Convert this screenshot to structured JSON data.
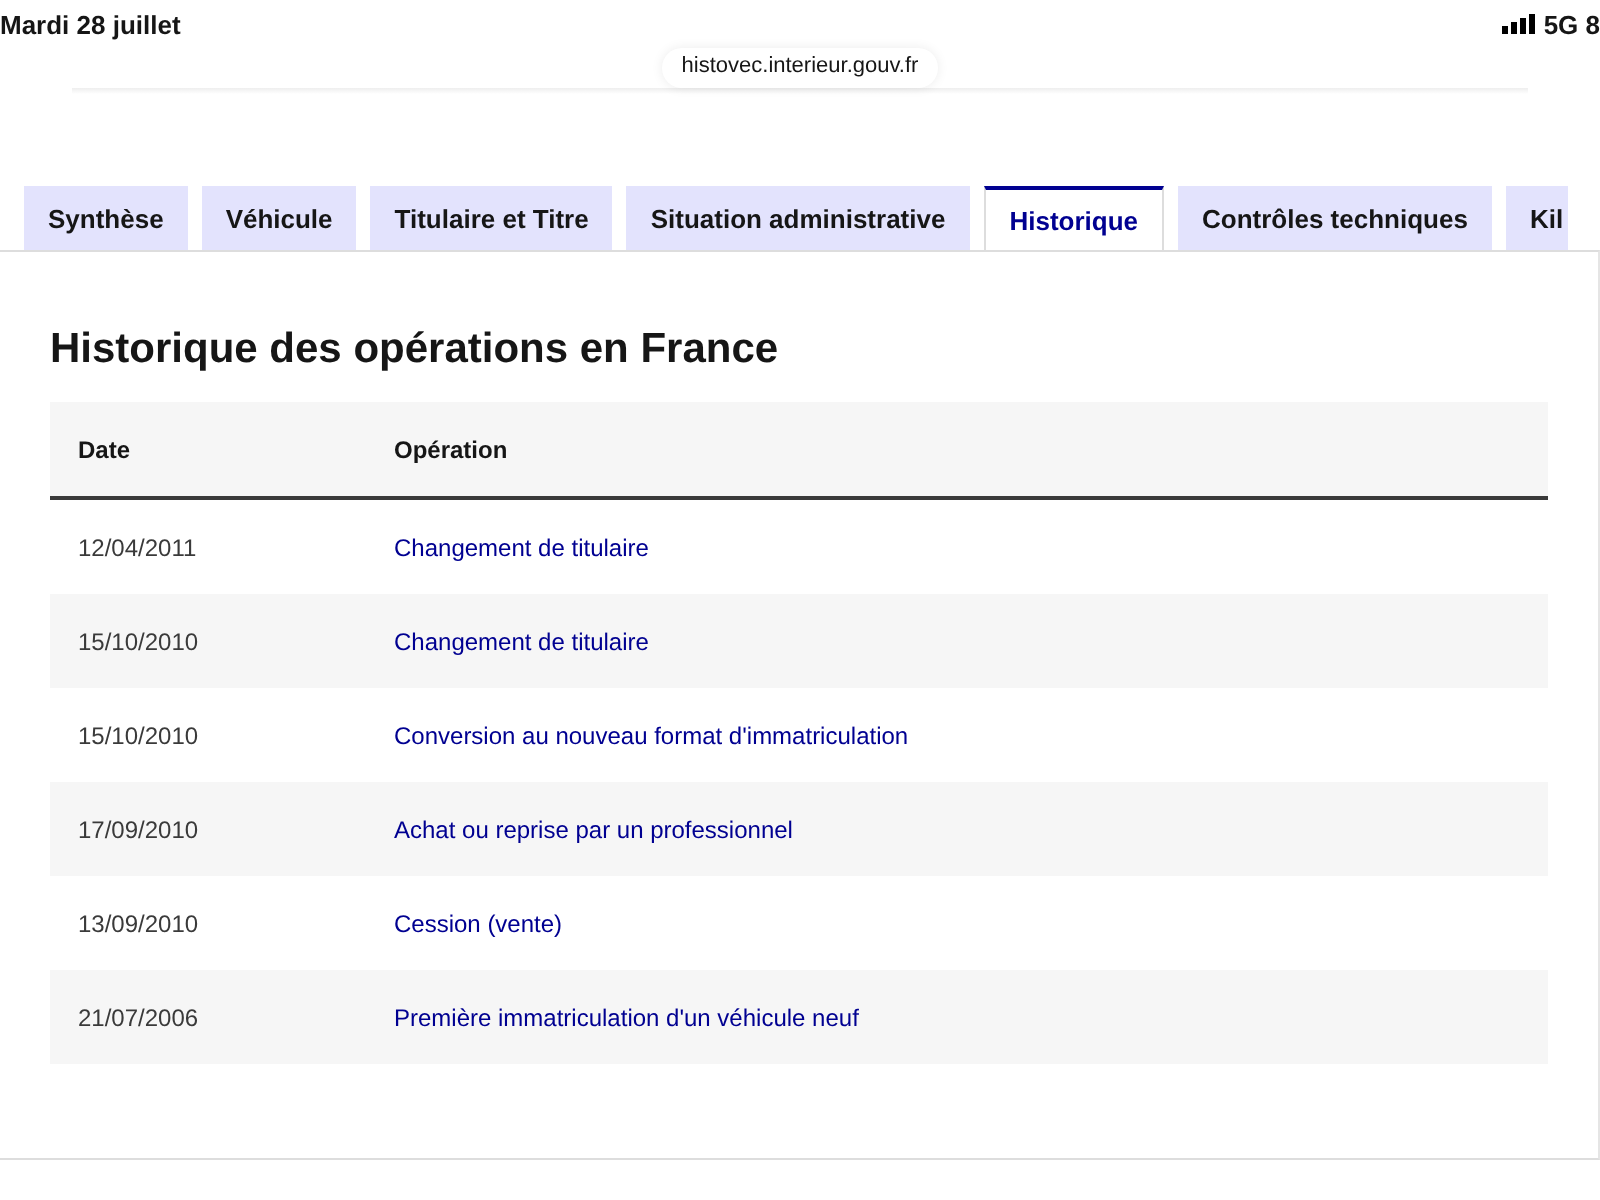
{
  "status_bar": {
    "date": "Mardi 28 juillet",
    "network": "5G 8"
  },
  "address_bar": {
    "url": "histovec.interieur.gouv.fr"
  },
  "tabs": [
    {
      "label": "Synthèse",
      "selected": false
    },
    {
      "label": "Véhicule",
      "selected": false
    },
    {
      "label": "Titulaire et Titre",
      "selected": false
    },
    {
      "label": "Situation administrative",
      "selected": false
    },
    {
      "label": "Historique",
      "selected": true
    },
    {
      "label": "Contrôles techniques",
      "selected": false
    },
    {
      "label": "Kil",
      "selected": false
    }
  ],
  "panel": {
    "title": "Historique des opérations en France",
    "table": {
      "columns": [
        "Date",
        "Opération"
      ],
      "rows": [
        {
          "date": "12/04/2011",
          "operation": "Changement de titulaire"
        },
        {
          "date": "15/10/2010",
          "operation": "Changement de titulaire"
        },
        {
          "date": "15/10/2010",
          "operation": "Conversion au nouveau format d'immatriculation"
        },
        {
          "date": "17/09/2010",
          "operation": "Achat ou reprise par un professionnel"
        },
        {
          "date": "13/09/2010",
          "operation": "Cession (vente)"
        },
        {
          "date": "21/07/2006",
          "operation": "Première immatriculation d'un véhicule neuf"
        }
      ]
    }
  }
}
